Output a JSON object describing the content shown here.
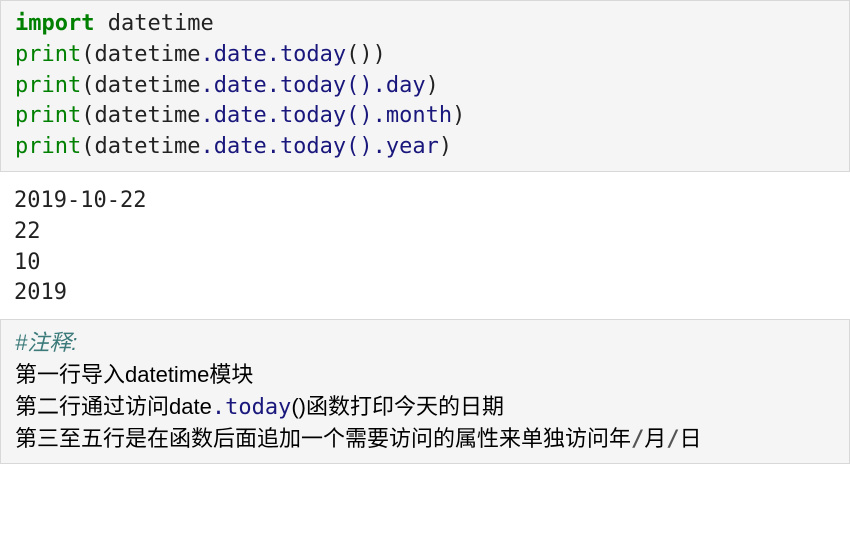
{
  "code1": {
    "l1": {
      "kw": "import",
      "mod": "datetime"
    },
    "l2": {
      "fn": "print",
      "mod": "datetime",
      "d1": ".",
      "a1": "date",
      "d2": ".",
      "a2": "today",
      "p": "())"
    },
    "l3": {
      "fn": "print",
      "mod": "datetime",
      "d1": ".",
      "a1": "date",
      "d2": ".",
      "a2": "today",
      "d3": "().",
      "a3": "day",
      "cp": ")"
    },
    "l4": {
      "fn": "print",
      "mod": "datetime",
      "d1": ".",
      "a1": "date",
      "d2": ".",
      "a2": "today",
      "d3": "().",
      "a3": "month",
      "cp": ")"
    },
    "l5": {
      "fn": "print",
      "mod": "datetime",
      "d1": ".",
      "a1": "date",
      "d2": ".",
      "a2": "today",
      "d3": "().",
      "a3": "year",
      "cp": ")"
    },
    "op": "(",
    "cp": ")"
  },
  "output": {
    "l1": "2019-10-22",
    "l2": "22",
    "l3": "10",
    "l4": "2019"
  },
  "code2": {
    "comment": "#注释:",
    "l2a": "第一行导入datetime模块",
    "l3a": "第二行通过访问date",
    "l3b": ".",
    "l3c": "today",
    "l3d": "()函数打印今天的日期",
    "l4a": "第三至五行是在函数后面追加一个需要访问的属性来单独访问年",
    "l4s": "/",
    "l4b": "月",
    "l4c": "日"
  }
}
